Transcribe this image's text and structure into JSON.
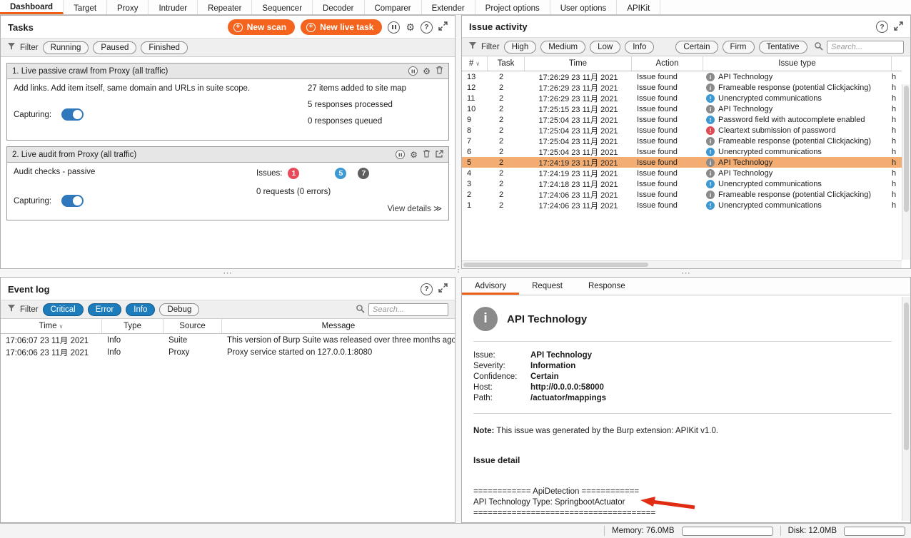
{
  "colors": {
    "accent_orange": "#ee6018",
    "button_orange": "#f4641e",
    "selected_row": "#f3ad72",
    "pill_blue": "#1d7cbc",
    "toggle_blue": "#2e78bb",
    "severity_info": "#8a8a8a",
    "severity_low": "#3d99d4",
    "severity_high": "#e04a52"
  },
  "tab_bar": {
    "selected": "Dashboard",
    "tabs": [
      "Dashboard",
      "Target",
      "Proxy",
      "Intruder",
      "Repeater",
      "Sequencer",
      "Decoder",
      "Comparer",
      "Extender",
      "Project options",
      "User options",
      "APIKit"
    ]
  },
  "tasks_panel": {
    "title": "Tasks",
    "new_scan": "New scan",
    "new_live_task": "New live task",
    "filter_label": "Filter",
    "filter_pills": [
      "Running",
      "Paused",
      "Finished"
    ],
    "tasks": [
      {
        "title": "1. Live passive crawl from Proxy (all traffic)",
        "description": "Add links. Add item itself, same domain and URLs in suite scope.",
        "capturing_label": "Capturing:",
        "stats": [
          "27 items added to site map",
          "5 responses processed",
          "0 responses queued"
        ]
      },
      {
        "title": "2. Live audit from Proxy (all traffic)",
        "description": "Audit checks - passive",
        "capturing_label": "Capturing:",
        "issues_label": "Issues:",
        "issue_counts": {
          "high": "1",
          "low": "5",
          "info": "7"
        },
        "requests": "0 requests (0 errors)",
        "view_details": "View details ≫"
      }
    ]
  },
  "issue_activity": {
    "title": "Issue activity",
    "filter_label": "Filter",
    "severity_pills": [
      "High",
      "Medium",
      "Low",
      "Info"
    ],
    "confidence_pills": [
      "Certain",
      "Firm",
      "Tentative"
    ],
    "search_placeholder": "Search...",
    "columns": [
      "#",
      "Task",
      "Time",
      "Action",
      "Issue type",
      ""
    ],
    "selected_row_num": "5",
    "rows": [
      {
        "num": "13",
        "task": "2",
        "time": "17:26:29 23 11月 2021",
        "action": "Issue found",
        "severity": "info",
        "issue": "API Technology",
        "url": "h"
      },
      {
        "num": "12",
        "task": "2",
        "time": "17:26:29 23 11月 2021",
        "action": "Issue found",
        "severity": "info",
        "issue": "Frameable response (potential Clickjacking)",
        "url": "h"
      },
      {
        "num": "11",
        "task": "2",
        "time": "17:26:29 23 11月 2021",
        "action": "Issue found",
        "severity": "low",
        "issue": "Unencrypted communications",
        "url": "h"
      },
      {
        "num": "10",
        "task": "2",
        "time": "17:25:15 23 11月 2021",
        "action": "Issue found",
        "severity": "info",
        "issue": "API Technology",
        "url": "h"
      },
      {
        "num": "9",
        "task": "2",
        "time": "17:25:04 23 11月 2021",
        "action": "Issue found",
        "severity": "low",
        "issue": "Password field with autocomplete enabled",
        "url": "h"
      },
      {
        "num": "8",
        "task": "2",
        "time": "17:25:04 23 11月 2021",
        "action": "Issue found",
        "severity": "high",
        "issue": "Cleartext submission of password",
        "url": "h"
      },
      {
        "num": "7",
        "task": "2",
        "time": "17:25:04 23 11月 2021",
        "action": "Issue found",
        "severity": "info",
        "issue": "Frameable response (potential Clickjacking)",
        "url": "h"
      },
      {
        "num": "6",
        "task": "2",
        "time": "17:25:04 23 11月 2021",
        "action": "Issue found",
        "severity": "low",
        "issue": "Unencrypted communications",
        "url": "h"
      },
      {
        "num": "5",
        "task": "2",
        "time": "17:24:19 23 11月 2021",
        "action": "Issue found",
        "severity": "info",
        "issue": "API Technology",
        "url": "h"
      },
      {
        "num": "4",
        "task": "2",
        "time": "17:24:19 23 11月 2021",
        "action": "Issue found",
        "severity": "info",
        "issue": "API Technology",
        "url": "h"
      },
      {
        "num": "3",
        "task": "2",
        "time": "17:24:18 23 11月 2021",
        "action": "Issue found",
        "severity": "low",
        "issue": "Unencrypted communications",
        "url": "h"
      },
      {
        "num": "2",
        "task": "2",
        "time": "17:24:06 23 11月 2021",
        "action": "Issue found",
        "severity": "info",
        "issue": "Frameable response (potential Clickjacking)",
        "url": "h"
      },
      {
        "num": "1",
        "task": "2",
        "time": "17:24:06 23 11月 2021",
        "action": "Issue found",
        "severity": "low",
        "issue": "Unencrypted communications",
        "url": "h"
      }
    ]
  },
  "event_log": {
    "title": "Event log",
    "filter_label": "Filter",
    "pills": [
      {
        "label": "Critical",
        "active": true
      },
      {
        "label": "Error",
        "active": true
      },
      {
        "label": "Info",
        "active": true
      },
      {
        "label": "Debug",
        "active": false
      }
    ],
    "search_placeholder": "Search...",
    "columns": [
      "Time",
      "Type",
      "Source",
      "Message"
    ],
    "rows": [
      {
        "time": "17:06:07 23 11月 2021",
        "type": "Info",
        "source": "Suite",
        "message": "This version of Burp Suite was released over three months ago. Pl"
      },
      {
        "time": "17:06:06 23 11月 2021",
        "type": "Info",
        "source": "Proxy",
        "message": "Proxy service started on 127.0.0.1:8080"
      }
    ]
  },
  "advisory": {
    "tabs": [
      "Advisory",
      "Request",
      "Response"
    ],
    "selected_tab": "Advisory",
    "title": "API Technology",
    "fields": [
      {
        "label": "Issue:",
        "value": "API Technology"
      },
      {
        "label": "Severity:",
        "value": "Information"
      },
      {
        "label": "Confidence:",
        "value": "Certain"
      },
      {
        "label": "Host:",
        "value": "http://0.0.0.0:58000"
      },
      {
        "label": "Path:",
        "value": "/actuator/mappings"
      }
    ],
    "note_label": "Note:",
    "note_text": " This issue was generated by the Burp extension: APIKit v1.0.",
    "detail_heading": "Issue detail",
    "detail_lines": [
      "============ ApiDetection ============",
      "API Technology Type: SpringbootActuator",
      "======================================"
    ]
  },
  "status_bar": {
    "memory": "Memory: 76.0MB",
    "disk": "Disk: 12.0MB"
  }
}
